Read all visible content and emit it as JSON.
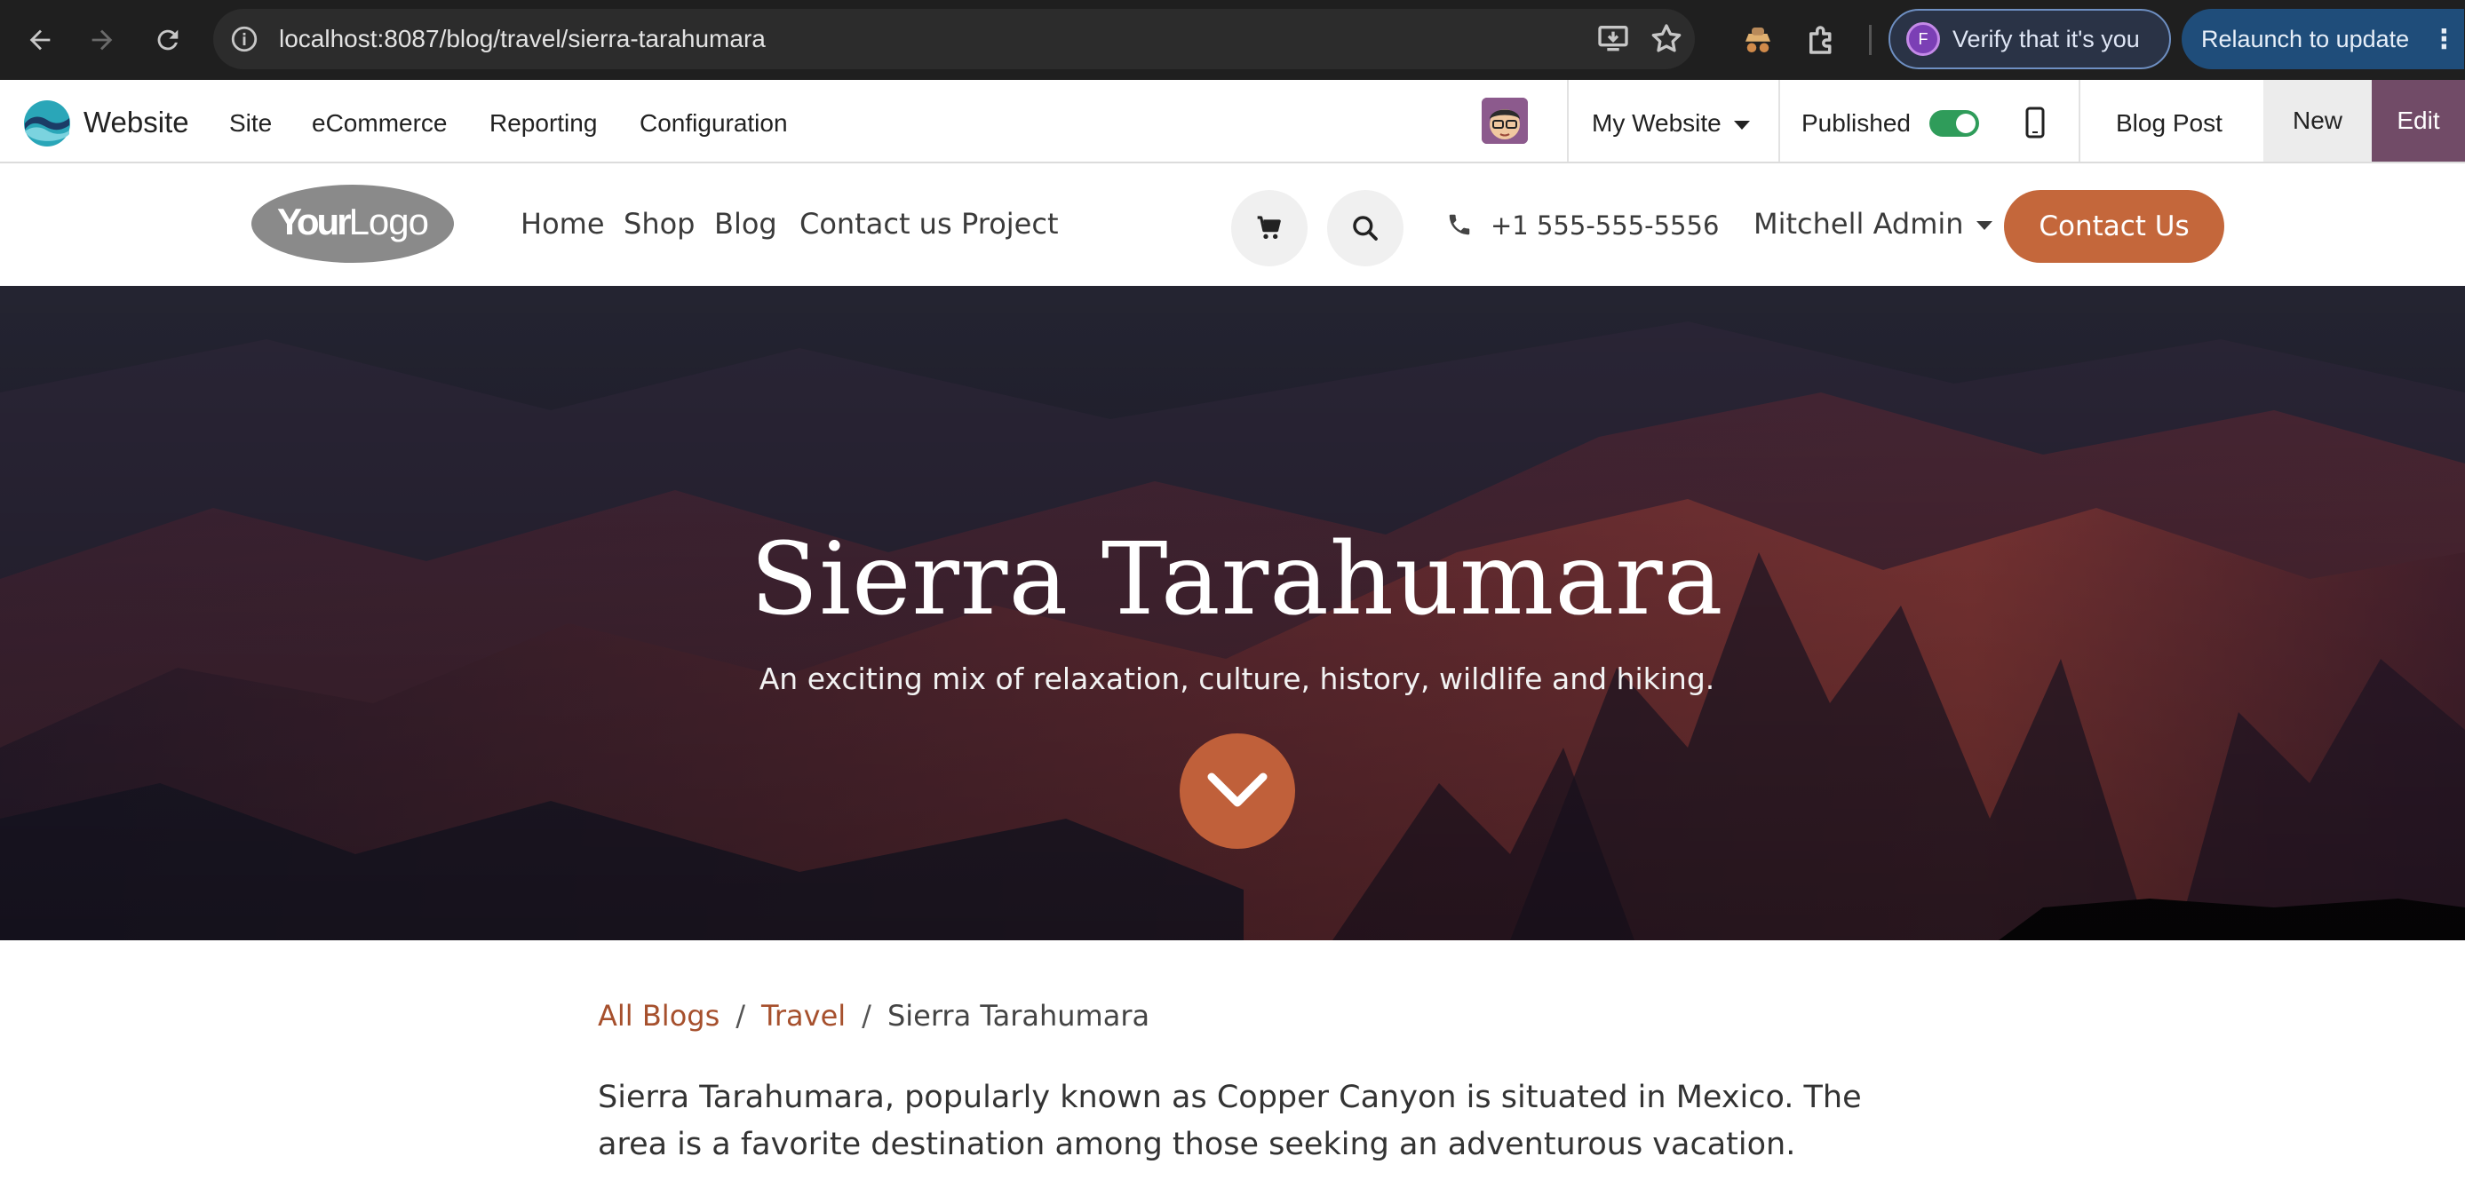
{
  "browser": {
    "url": "localhost:8087/blog/travel/sierra-tarahumara",
    "verify_label": "Verify that it's you",
    "profile_initial": "F",
    "relaunch_label": "Relaunch to update"
  },
  "admin_bar": {
    "app_name": "Website",
    "menu": [
      "Site",
      "eCommerce",
      "Reporting",
      "Configuration"
    ],
    "website_selector": "My Website",
    "published_label": "Published",
    "published": true,
    "blog_post_label": "Blog Post",
    "new_label": "New",
    "edit_label": "Edit"
  },
  "site_header": {
    "logo_text": "YourLogo",
    "nav": [
      "Home",
      "Shop",
      "Blog",
      "Contact us",
      "Project"
    ],
    "phone": "+1 555-555-5556",
    "user": "Mitchell Admin",
    "cta": "Contact Us"
  },
  "hero": {
    "title": "Sierra Tarahumara",
    "subtitle": "An exciting mix of relaxation, culture, history, wildlife and hiking."
  },
  "breadcrumb": {
    "all_blogs": "All Blogs",
    "category": "Travel",
    "current": "Sierra Tarahumara",
    "separator": "/"
  },
  "article": {
    "intro": "Sierra Tarahumara, popularly known as Copper Canyon is situated in Mexico. The area is a favorite destination among those seeking an adventurous vacation."
  },
  "colors": {
    "accent": "#c4673b",
    "link": "#a6502d",
    "edit_purple": "#714b67",
    "toggle_green": "#2f9c5a"
  }
}
